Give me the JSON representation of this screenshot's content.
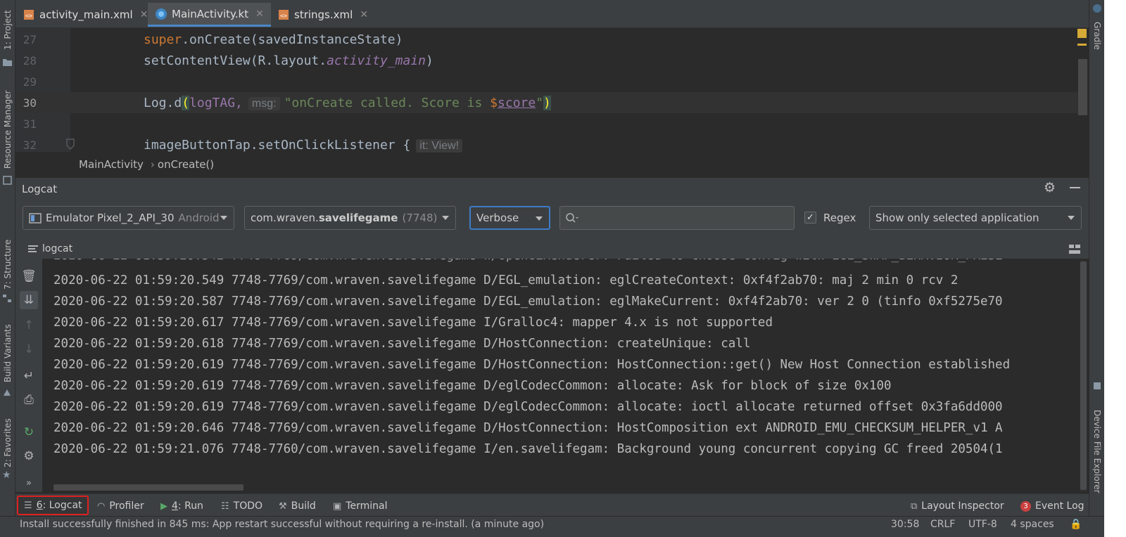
{
  "tabs": [
    {
      "label": "activity_main.xml",
      "icon": "xml-file-icon",
      "active": false
    },
    {
      "label": "MainActivity.kt",
      "icon": "kotlin-file-icon",
      "active": true
    },
    {
      "label": "strings.xml",
      "icon": "xml-file-icon",
      "active": false
    }
  ],
  "left_strip": {
    "project": "1: Project",
    "resource_manager": "Resource Manager",
    "structure": "7: Structure",
    "build_variants": "Build Variants",
    "favorites": "2: Favorites"
  },
  "right_strip": {
    "gradle": "Gradle",
    "device_file_explorer": "Device File Explorer"
  },
  "code": {
    "lines": [
      {
        "num": "27",
        "a": "super",
        "b": ".onCreate(savedInstanceState)"
      },
      {
        "num": "28",
        "a": "setContentView(R.layout.",
        "b": "activity_main",
        "c": ")"
      },
      {
        "num": "29"
      },
      {
        "num": "30",
        "a": "Log.d",
        "open": "(",
        "arg1": "logTAG,",
        "hint": "msg:",
        "str_start": "\"onCreate called. Score is ",
        "dollar": "$",
        "var": "score",
        "str_end": "\"",
        "close": ")"
      },
      {
        "num": "31"
      },
      {
        "num": "32",
        "a": "imageButtonTap.setOnClickListener {",
        "hint": "it: View!"
      }
    ]
  },
  "breadcrumb": {
    "class": "MainActivity",
    "method": "onCreate()",
    "separator": "›"
  },
  "logcat": {
    "title": "Logcat",
    "device": "Emulator Pixel_2_API_30",
    "device_suffix": "Android",
    "process_prefix": "com.wraven.",
    "process_bold": "savelifegame",
    "process_pid": "(7748)",
    "level": "Verbose",
    "search_value": "",
    "regex_label": "Regex",
    "regex_checked": true,
    "filter": "Show only selected application",
    "tab_label": "logcat",
    "lines": [
      "2020-06-22 01:59:20.549 7748-7769/com.wraven.savelifegame D/EGL_emulation: eglCreateContext: 0xf4f2ab70: maj 2 min 0 rcv 2",
      "2020-06-22 01:59:20.587 7748-7769/com.wraven.savelifegame D/EGL_emulation: eglMakeCurrent: 0xf4f2ab70: ver 2 0 (tinfo 0xf5275e70",
      "2020-06-22 01:59:20.617 7748-7769/com.wraven.savelifegame I/Gralloc4: mapper 4.x is not supported",
      "2020-06-22 01:59:20.618 7748-7769/com.wraven.savelifegame D/HostConnection: createUnique: call",
      "2020-06-22 01:59:20.619 7748-7769/com.wraven.savelifegame D/HostConnection: HostConnection::get() New Host Connection established",
      "2020-06-22 01:59:20.619 7748-7769/com.wraven.savelifegame D/eglCodecCommon: allocate: Ask for block of size 0x100",
      "2020-06-22 01:59:20.619 7748-7769/com.wraven.savelifegame D/eglCodecCommon: allocate: ioctl allocate returned offset 0x3fa6dd000",
      "2020-06-22 01:59:20.646 7748-7769/com.wraven.savelifegame D/HostConnection: HostComposition ext ANDROID_EMU_CHECKSUM_HELPER_v1 A",
      "2020-06-22 01:59:21.076 7748-7760/com.wraven.savelifegame I/en.savelifegam: Background young concurrent copying GC freed 20504(1"
    ]
  },
  "bottom_bar": {
    "logcat_num": "6",
    "logcat_label": ": Logcat",
    "profiler": "Profiler",
    "run_num": "4",
    "run_label": ": Run",
    "todo": "TODO",
    "build": "Build",
    "terminal": "Terminal",
    "layout_inspector": "Layout Inspector",
    "event_log": "Event Log",
    "event_count": "3"
  },
  "status_bar": {
    "message": "Install successfully finished in 845 ms: App restart successful without requiring a re-install. (a minute ago)",
    "position": "30:58",
    "line_sep": "CRLF",
    "encoding": "UTF-8",
    "indent": "4 spaces"
  },
  "colors": {
    "accent": "#3d7bc7",
    "highlight_border": "#e0201f",
    "background": "#2b2b2b",
    "panel": "#3c3f41"
  }
}
